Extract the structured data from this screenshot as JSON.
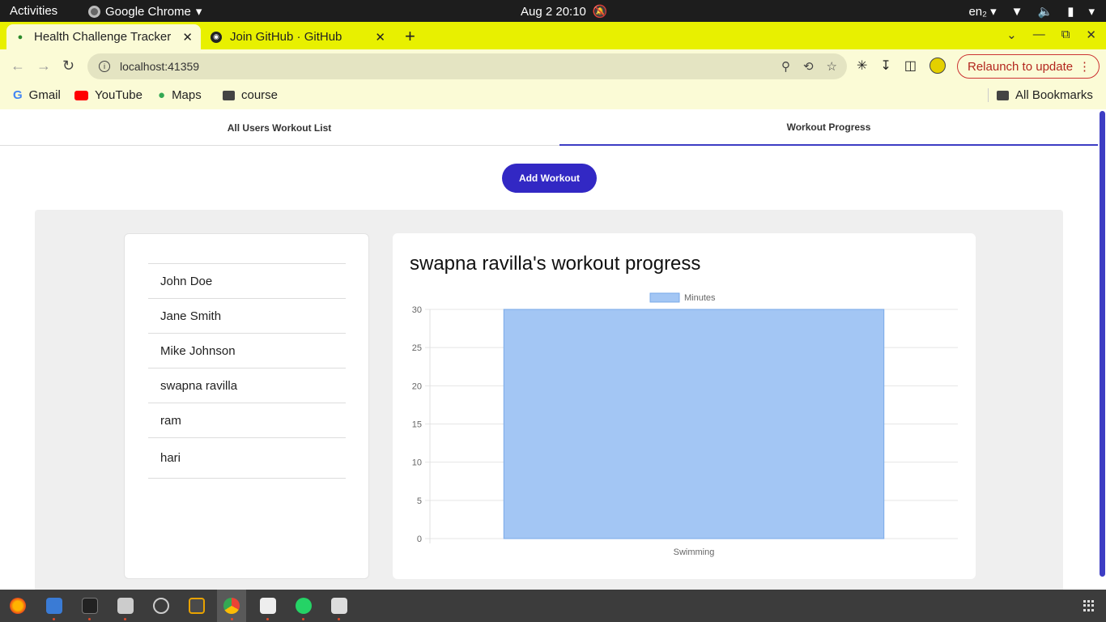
{
  "system_bar": {
    "activities": "Activities",
    "app_name": "Google Chrome",
    "datetime": "Aug 2  20:10",
    "keyboard": "en₂"
  },
  "browser": {
    "tabs": [
      {
        "title": "Health Challenge Tracker",
        "active": true
      },
      {
        "title": "Join GitHub · GitHub",
        "active": false
      }
    ],
    "url": "localhost:41359",
    "relaunch_label": "Relaunch to update",
    "bookmarks": [
      "Gmail",
      "YouTube",
      "Maps",
      "course"
    ],
    "all_bookmarks": "All Bookmarks"
  },
  "app": {
    "tabs": [
      "All Users Workout List",
      "Workout Progress"
    ],
    "active_tab": "Workout Progress",
    "add_button": "Add Workout",
    "users": [
      "John Doe",
      "Jane Smith",
      "Mike Johnson",
      "swapna ravilla",
      "ram",
      "hari"
    ],
    "chart_title": "swapna ravilla's workout progress"
  },
  "chart_data": {
    "type": "bar",
    "categories": [
      "Swimming"
    ],
    "series": [
      {
        "name": "Minutes",
        "values": [
          30
        ],
        "color": "#a3c6f4",
        "border": "#7aaae8"
      }
    ],
    "ylim": [
      0,
      30
    ],
    "yticks": [
      0,
      5,
      10,
      15,
      20,
      25,
      30
    ],
    "legend": "top",
    "grid": true
  },
  "colors": {
    "accent": "#3228c4",
    "tabstrip": "#e8f000",
    "toolbar": "#fbfbd6"
  }
}
